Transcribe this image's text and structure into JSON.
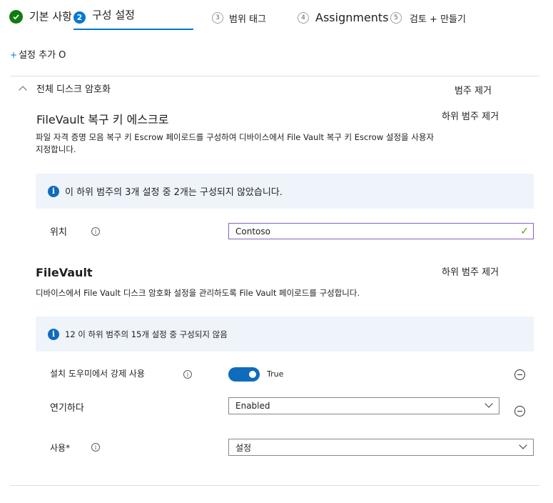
{
  "wizard": {
    "steps": [
      {
        "number": "",
        "label": "기본 사항"
      },
      {
        "number": "2",
        "label": "구성 설정"
      },
      {
        "number": "3",
        "label": "범위 태그"
      },
      {
        "number": "4",
        "label": "Assignments"
      },
      {
        "number": "5",
        "label": "검토 + 만들기"
      }
    ]
  },
  "toolbar": {
    "add_plus": "+",
    "add_setting_label": "설정 추가 O"
  },
  "category": {
    "title": "전체 디스크 암호화",
    "remove_label": "범주 제거"
  },
  "escrow": {
    "title": "FileVault 복구 키 에스크로",
    "remove_label": "하위 범주 제거",
    "description": "파일 자격 증명 모음 복구 키 Escrow 페이로드를 구성하여 디바이스에서 File Vault 복구 키 Escrow 설정을 사용자 지정합니다.",
    "info": "이 하위 범주의 3개 설정 중 2개는 구성되지 않았습니다.",
    "location_label": "위치",
    "location_value": "Contoso"
  },
  "filevault": {
    "title": "FileVault",
    "remove_label": "하위 범주 제거",
    "description": "디바이스에서 File Vault 디스크 암호화 설정을 관리하도록 File Vault 페이로드를 구성합니다.",
    "info": "12 이 하위 범주의 15개 설정 중 구성되지 않음",
    "settings": {
      "enforce_label": "설치 도우미에서 강제 사용",
      "enforce_value": "True",
      "defer_label": "연기하다",
      "defer_value": "Enabled",
      "enable_label": "사용*",
      "enable_value": "설정"
    }
  },
  "icons": {
    "info_glyph": "i",
    "check_glyph": "✓"
  },
  "colors": {
    "accent": "#0078d4",
    "success": "#107c10",
    "info_bg": "#eff4fb"
  }
}
